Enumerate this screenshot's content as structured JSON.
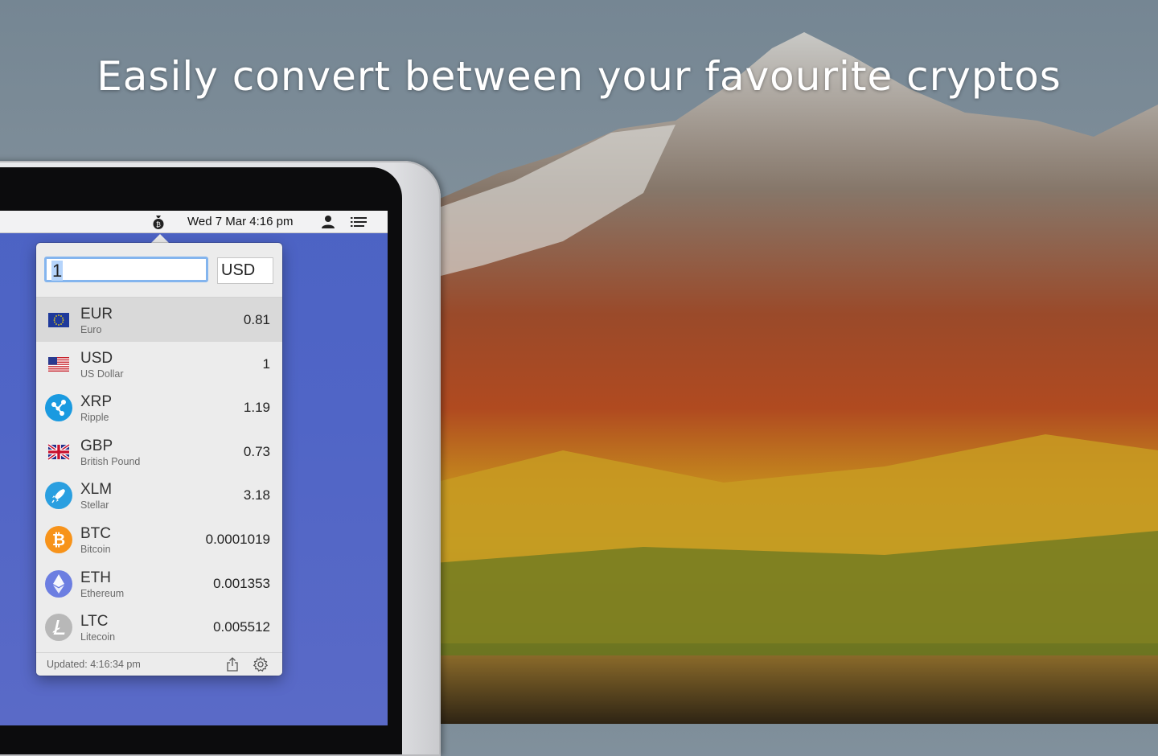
{
  "headline": "Easily convert between your favourite cryptos",
  "menubar": {
    "clock": "Wed 7 Mar  4:16 pm",
    "icons": [
      "money-bag-icon",
      "user-icon",
      "list-icon"
    ]
  },
  "converter": {
    "amount": "1",
    "base_currency": "USD",
    "rows": [
      {
        "code": "EUR",
        "name": "Euro",
        "value": "0.81",
        "icon": "eu-flag-icon",
        "selected": true
      },
      {
        "code": "USD",
        "name": "US Dollar",
        "value": "1",
        "icon": "us-flag-icon"
      },
      {
        "code": "XRP",
        "name": "Ripple",
        "value": "1.19",
        "icon": "ripple-icon"
      },
      {
        "code": "GBP",
        "name": "British Pound",
        "value": "0.73",
        "icon": "uk-flag-icon"
      },
      {
        "code": "XLM",
        "name": "Stellar",
        "value": "3.18",
        "icon": "stellar-rocket-icon"
      },
      {
        "code": "BTC",
        "name": "Bitcoin",
        "value": "0.0001019",
        "icon": "bitcoin-icon"
      },
      {
        "code": "ETH",
        "name": "Ethereum",
        "value": "0.001353",
        "icon": "ethereum-icon"
      },
      {
        "code": "LTC",
        "name": "Litecoin",
        "value": "0.005512",
        "icon": "litecoin-icon"
      }
    ],
    "footer": {
      "updated": "Updated:  4:16:34 pm"
    }
  },
  "colors": {
    "desktop_blue": "#4c63c4",
    "input_focus": "#84b5ee",
    "xrp": "#1a9ae0",
    "xlm": "#2a9fe0",
    "btc": "#f7931a",
    "eth": "#6c7ee1",
    "ltc": "#b8b8b8"
  }
}
